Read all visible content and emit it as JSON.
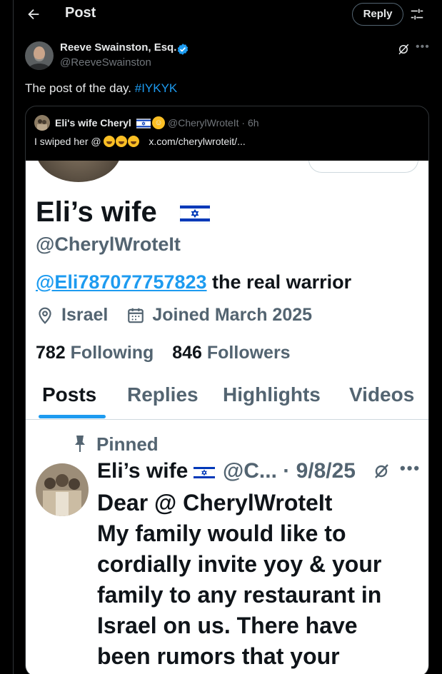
{
  "header": {
    "title": "Post",
    "reply_label": "Reply"
  },
  "author": {
    "name": "Reeve Swainston, Esq.",
    "handle": "@ReeveSwainston"
  },
  "post": {
    "text": "The post of the day. ",
    "hashtag": "#IYKYK"
  },
  "quote": {
    "name": "Eli's wife Cheryl",
    "handle_time": "@CherylWroteIt · 6h",
    "text_prefix": "I swiped her @",
    "link": "x.com/cherylwroteit/..."
  },
  "screenshot": {
    "name": "Eli’s wife",
    "handle": "@CherylWroteIt",
    "bio_mention": "@Eli787077757823",
    "bio_rest": " the real warrior",
    "location": "Israel",
    "joined": "Joined March 2025",
    "following_count": "782",
    "following_label": " Following",
    "followers_count": "846",
    "followers_label": " Followers",
    "tabs": [
      "Posts",
      "Replies",
      "Highlights",
      "Videos"
    ],
    "pinned_label": "Pinned",
    "pinned_post": {
      "name": "Eli’s wife",
      "handle_date": "@C... · 9/8/25",
      "lines": [
        "Dear @ CherylWroteIt",
        "My family would like to",
        "cordially invite yoy & your",
        "family to any restaurant in",
        "Israel on us. There have",
        "been rumors that your"
      ]
    }
  },
  "colors": {
    "accent": "#1d9bf0",
    "background": "#000000",
    "muted": "#71767b"
  }
}
